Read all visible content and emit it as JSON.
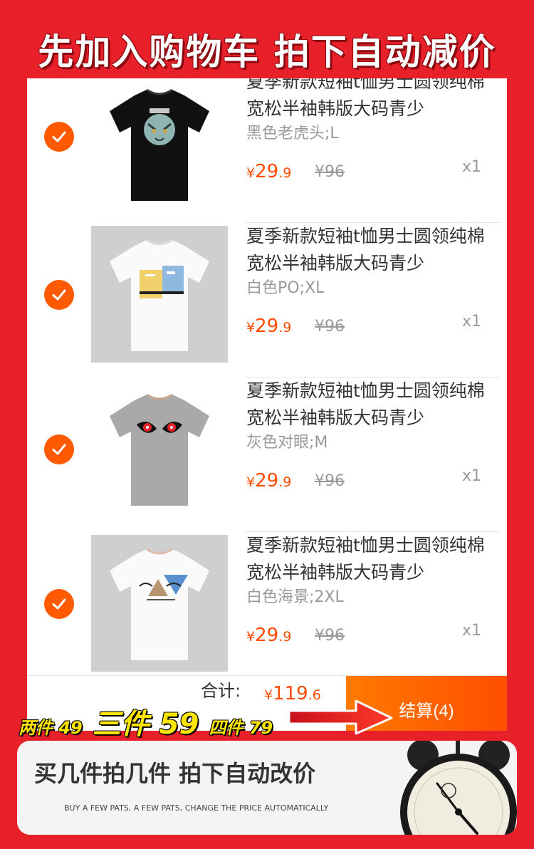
{
  "headline": "先加入购物车  拍下自动减价",
  "items": [
    {
      "title": "夏季新款短袖t恤男士圆领纯棉宽松半袖韩版大码青少",
      "sku": "黑色老虎头;L",
      "price_symbol": "¥",
      "price_int": "29",
      "price_dec": ".9",
      "original_price": "¥96",
      "qty": "x1",
      "selected": true,
      "image": "black-tshirt-tiger"
    },
    {
      "title": "夏季新款短袖t恤男士圆领纯棉宽松半袖韩版大码青少",
      "sku": "白色PO;XL",
      "price_symbol": "¥",
      "price_int": "29",
      "price_dec": ".9",
      "original_price": "¥96",
      "qty": "x1",
      "selected": true,
      "image": "white-tshirt-po"
    },
    {
      "title": "夏季新款短袖t恤男士圆领纯棉宽松半袖韩版大码青少",
      "sku": "灰色对眼;M",
      "price_symbol": "¥",
      "price_int": "29",
      "price_dec": ".9",
      "original_price": "¥96",
      "qty": "x1",
      "selected": true,
      "image": "gray-tshirt-eyes"
    },
    {
      "title": "夏季新款短袖t恤男士圆领纯棉宽松半袖韩版大码青少",
      "sku": "白色海景;2XL",
      "price_symbol": "¥",
      "price_int": "29",
      "price_dec": ".9",
      "original_price": "¥96",
      "qty": "x1",
      "selected": true,
      "image": "white-tshirt-seascape"
    }
  ],
  "bottom_bar": {
    "total_label": "合计:",
    "total_symbol": "¥",
    "total_int": "119",
    "total_dec": ".6",
    "checkout_label": "结算(4)"
  },
  "promo": {
    "two": "两件 49",
    "three": "三件 59",
    "four": "四件 79"
  },
  "footer": {
    "title": "买几件拍几件  拍下自动改价",
    "subtitle": "BUY A FEW PATS, A FEW PATS, CHANGE THE PRICE AUTOMATICALLY"
  },
  "colors": {
    "background": "#e8202a",
    "accent": "#ff5a00",
    "price": "#ff4a00",
    "promo_text": "#ffe600"
  }
}
